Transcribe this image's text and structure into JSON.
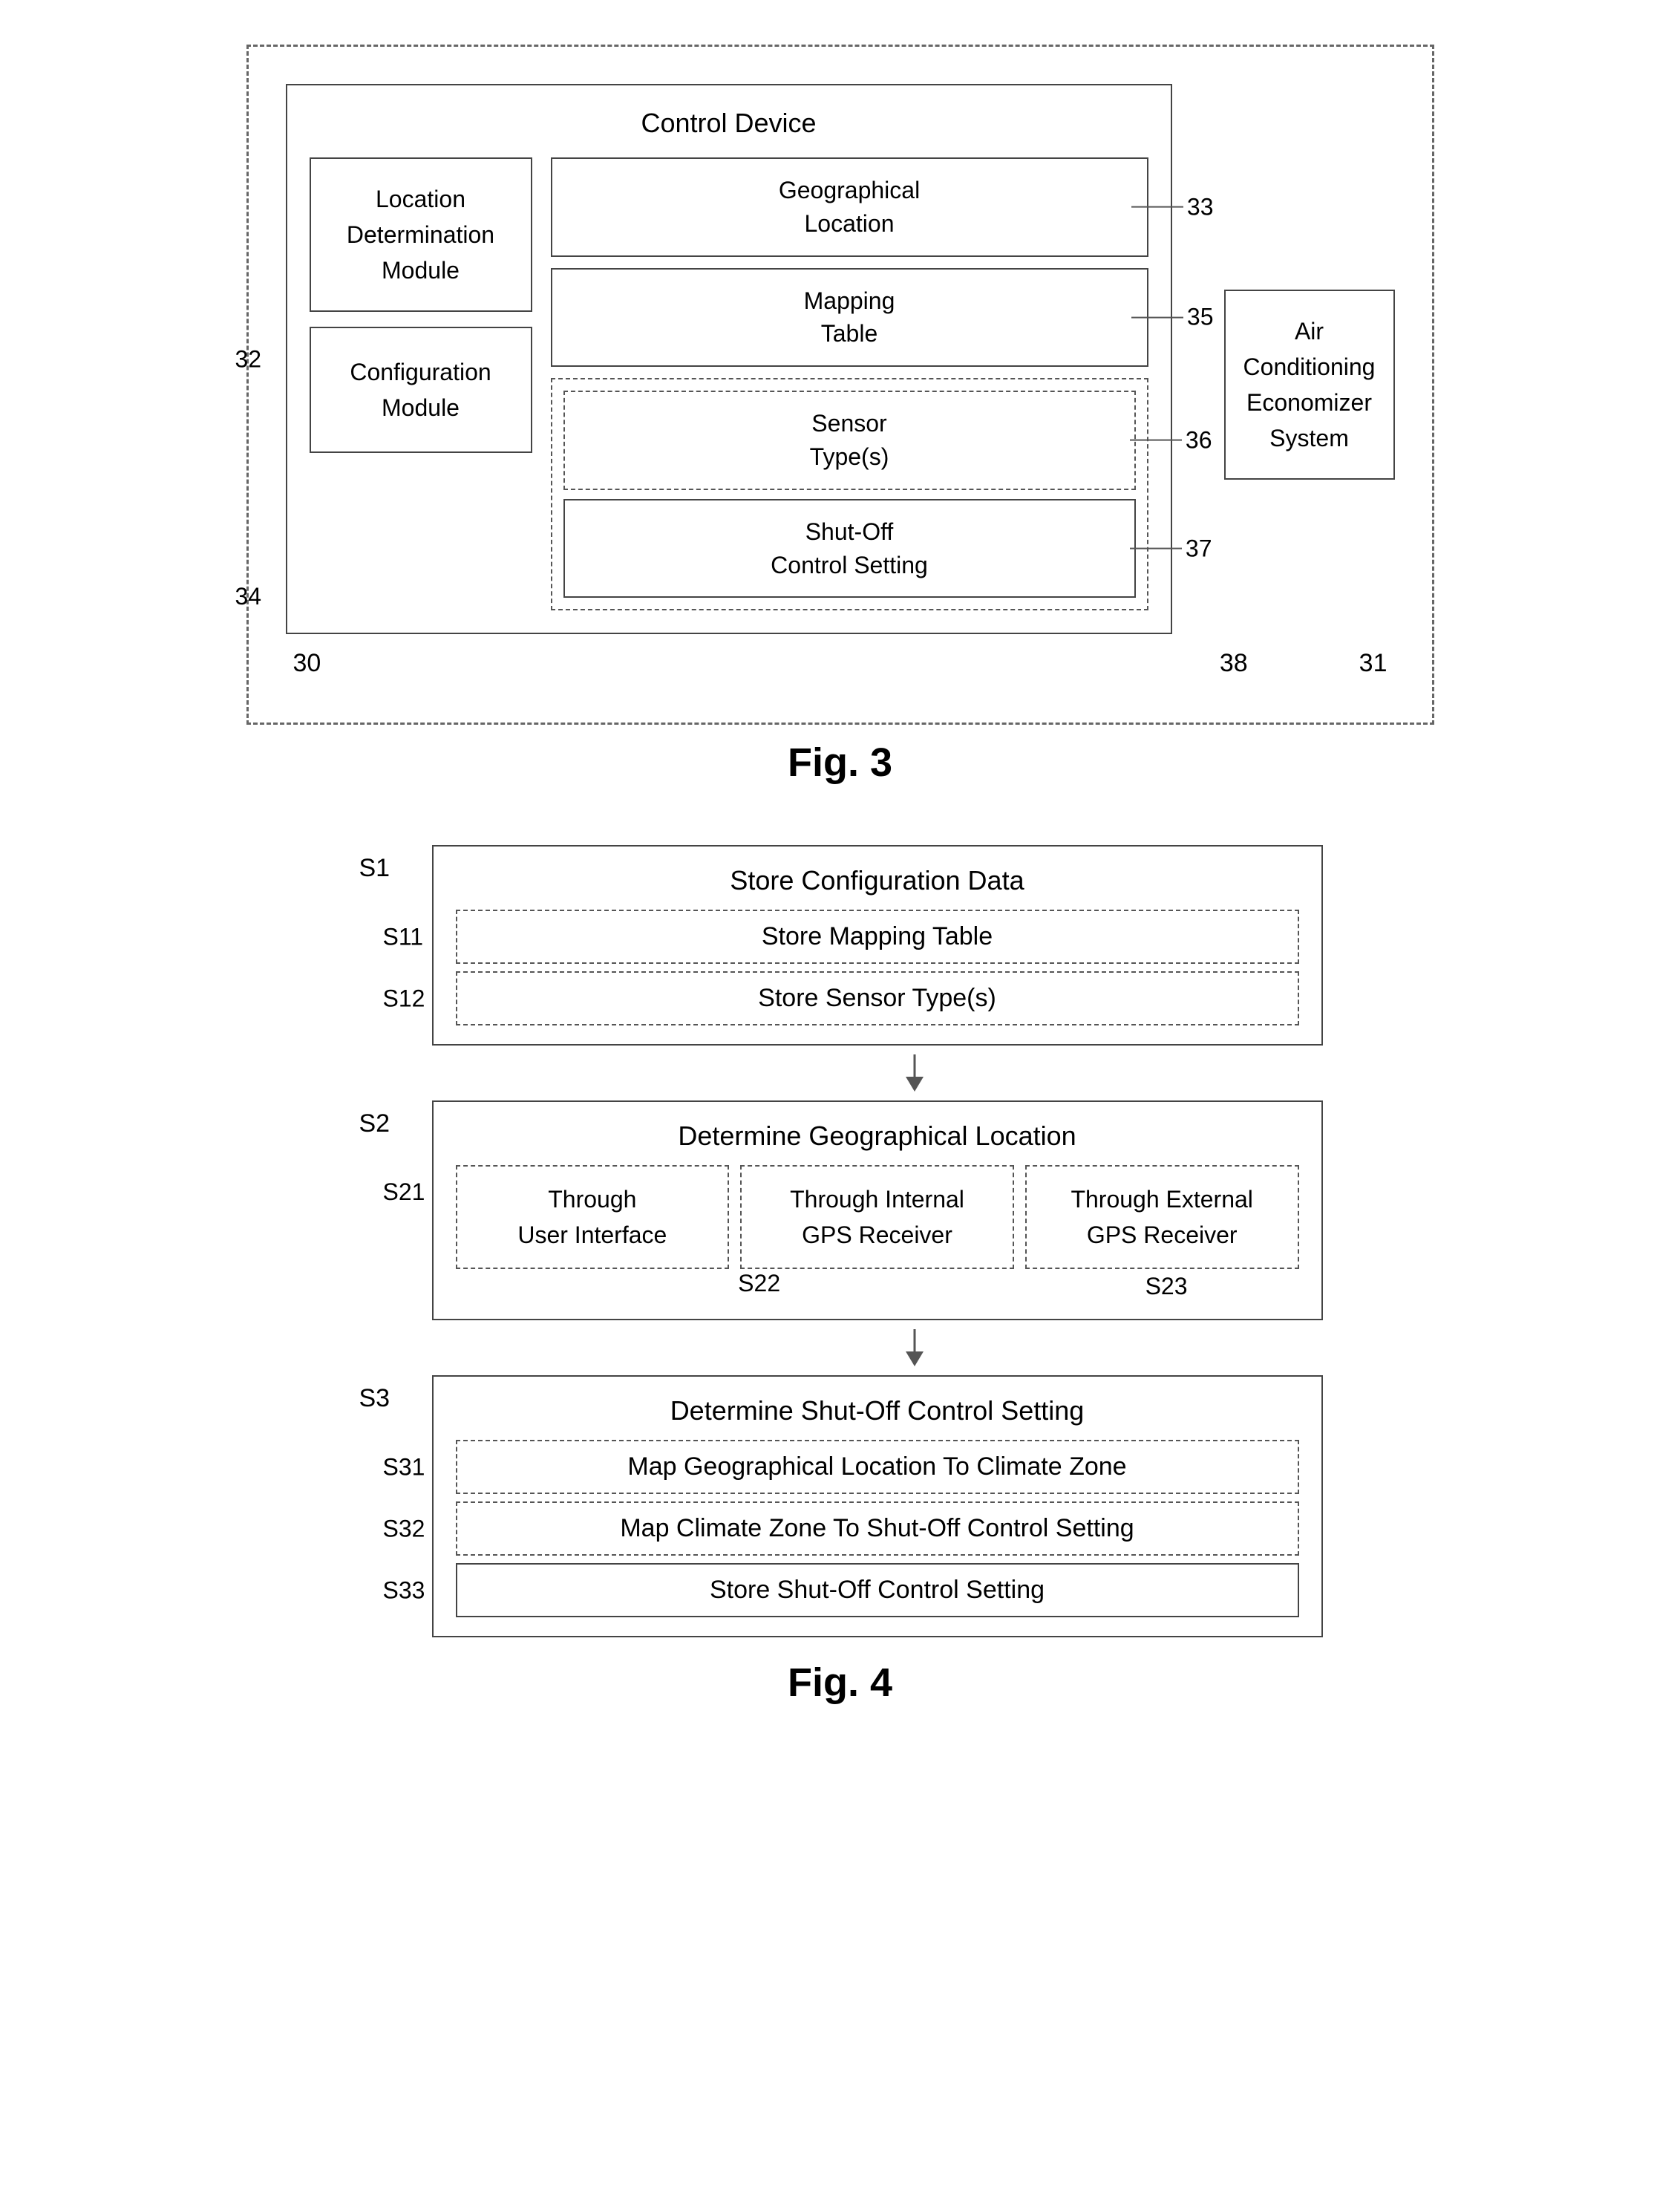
{
  "fig3": {
    "caption": "Fig. 3",
    "control_device_title": "Control Device",
    "location_determination_module": "Location\nDetermination\nModule",
    "configuration_module": "Configuration\nModule",
    "geographical_location": "Geographical\nLocation",
    "mapping_table": "Mapping\nTable",
    "sensor_types": "Sensor\nType(s)",
    "shutoff_control_setting": "Shut-Off\nControl Setting",
    "air_conditioning_economizer": "Air\nConditioning\nEconomizer\nSystem",
    "ref_32": "32",
    "ref_33": "33",
    "ref_34": "34",
    "ref_35": "35",
    "ref_36": "36",
    "ref_37": "37",
    "ref_38": "38",
    "ref_30": "30",
    "ref_31": "31"
  },
  "fig4": {
    "caption": "Fig. 4",
    "s1_label": "S1",
    "s1_title": "Store Configuration Data",
    "s11_label": "S11",
    "s11_text": "Store Mapping Table",
    "s12_label": "S12",
    "s12_text": "Store Sensor Type(s)",
    "s2_label": "S2",
    "s2_title": "Determine Geographical Location",
    "s21_label": "S21",
    "s21_text": "Through\nUser Interface",
    "s22_label": "S22",
    "s22_text": "Through Internal\nGPS Receiver",
    "s23_label": "S23",
    "s23_text": "Through External\nGPS Receiver",
    "s3_label": "S3",
    "s3_title": "Determine Shut-Off Control Setting",
    "s31_label": "S31",
    "s31_text": "Map Geographical Location To Climate Zone",
    "s32_label": "S32",
    "s32_text": "Map Climate Zone To Shut-Off Control Setting",
    "s33_label": "S33",
    "s33_text": "Store Shut-Off Control Setting"
  }
}
